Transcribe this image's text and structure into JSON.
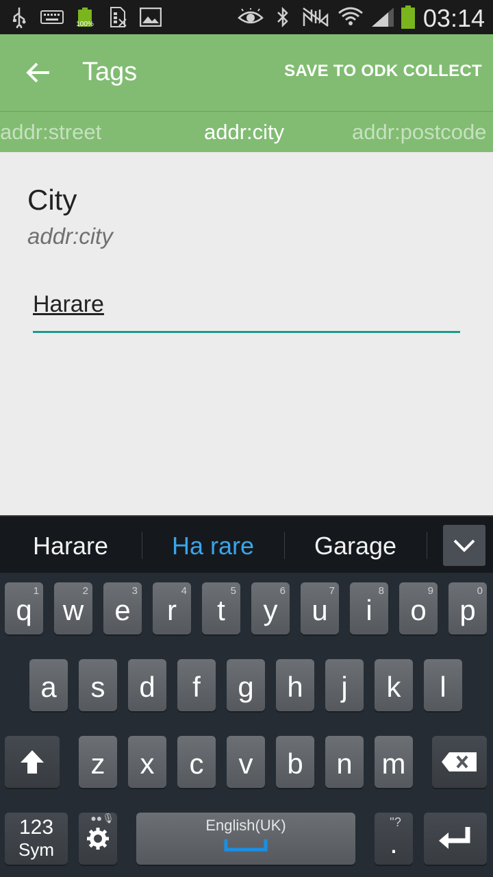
{
  "status_bar": {
    "battery_percent": "100%",
    "time": "03:14"
  },
  "app_bar": {
    "title": "Tags",
    "action": "SAVE TO ODK COLLECT"
  },
  "tag_tabs": [
    "addr:street",
    "addr:city",
    "addr:postcode"
  ],
  "field": {
    "title": "City",
    "key": "addr:city",
    "value": "Harare"
  },
  "keyboard": {
    "suggestions": [
      "Harare",
      "Ha rare",
      "Garage"
    ],
    "row1": [
      {
        "key": "q",
        "hint": "1"
      },
      {
        "key": "w",
        "hint": "2"
      },
      {
        "key": "e",
        "hint": "3"
      },
      {
        "key": "r",
        "hint": "4"
      },
      {
        "key": "t",
        "hint": "5"
      },
      {
        "key": "y",
        "hint": "6"
      },
      {
        "key": "u",
        "hint": "7"
      },
      {
        "key": "i",
        "hint": "8"
      },
      {
        "key": "o",
        "hint": "9"
      },
      {
        "key": "p",
        "hint": "0"
      }
    ],
    "row2": [
      "a",
      "s",
      "d",
      "f",
      "g",
      "h",
      "j",
      "k",
      "l"
    ],
    "row3": [
      "z",
      "x",
      "c",
      "v",
      "b",
      "n",
      "m"
    ],
    "sym_top": "123",
    "sym_bottom": "Sym",
    "language": "English(UK)",
    "period": ".",
    "period_hint": "''?"
  }
}
